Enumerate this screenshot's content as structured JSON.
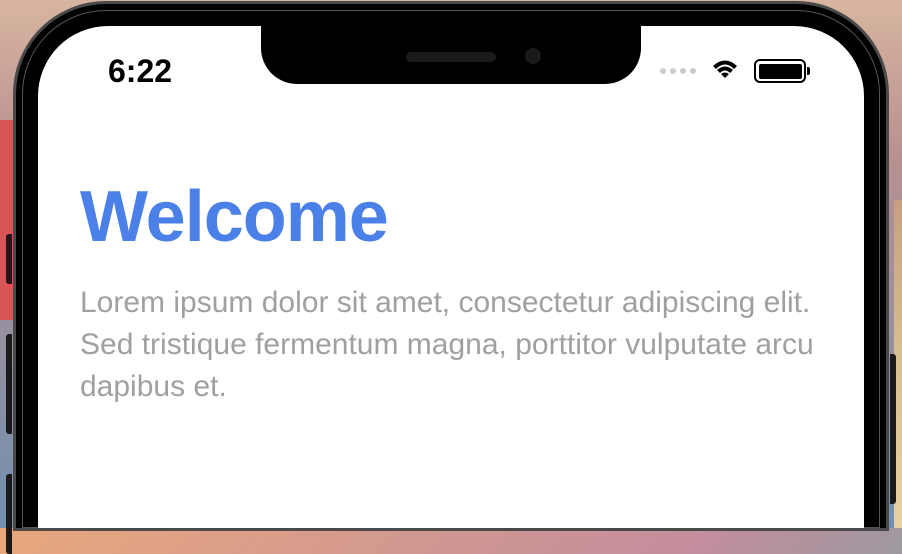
{
  "statusBar": {
    "time": "6:22"
  },
  "content": {
    "title": "Welcome",
    "body": "Lorem ipsum dolor sit amet, consectetur adipiscing elit. Sed tristique fermentum magna, porttitor vulputate arcu dapibus et."
  }
}
